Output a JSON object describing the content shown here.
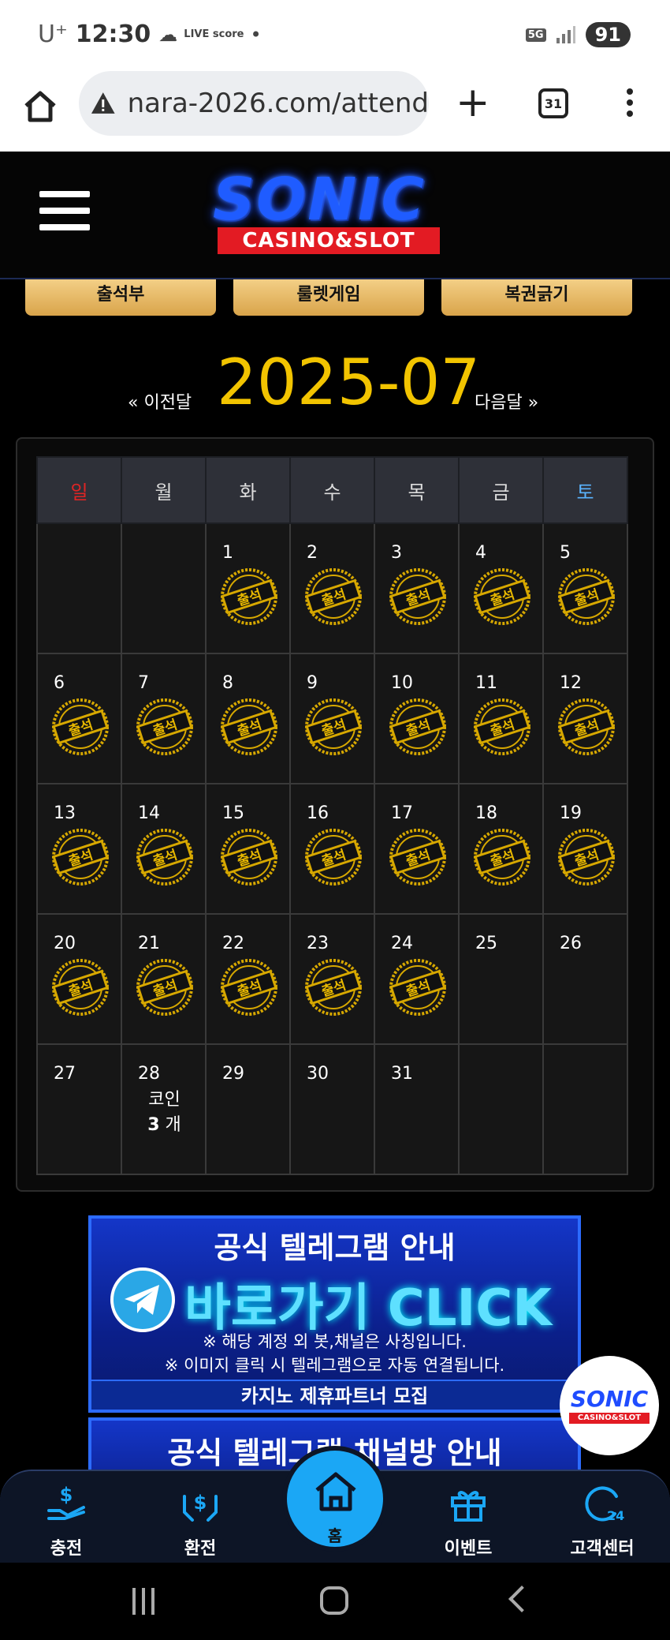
{
  "status_bar": {
    "carrier": "U⁺",
    "time": "12:30",
    "live_label": "LIVE score",
    "network": "5G",
    "battery": "91"
  },
  "browser": {
    "url": "nara-2026.com/attend",
    "tab_count": "31"
  },
  "site": {
    "logo_main": "SONIC",
    "logo_sub": "CASINO&SLOT"
  },
  "top_menu": [
    "출석부",
    "룰렛게임",
    "복권긁기"
  ],
  "calendar": {
    "prev_label": "« 이전달",
    "month_title": "2025-07",
    "next_label": "다음달 »",
    "weekdays": [
      "일",
      "월",
      "화",
      "수",
      "목",
      "금",
      "토"
    ],
    "weeks": [
      [
        "",
        "",
        "1",
        "2",
        "3",
        "4",
        "5"
      ],
      [
        "6",
        "7",
        "8",
        "9",
        "10",
        "11",
        "12"
      ],
      [
        "13",
        "14",
        "15",
        "16",
        "17",
        "18",
        "19"
      ],
      [
        "20",
        "21",
        "22",
        "23",
        "24",
        "25",
        "26"
      ],
      [
        "27",
        "28",
        "29",
        "30",
        "31",
        "",
        ""
      ]
    ],
    "attended_days": [
      "1",
      "2",
      "3",
      "4",
      "5",
      "6",
      "7",
      "8",
      "9",
      "10",
      "11",
      "12",
      "13",
      "14",
      "15",
      "16",
      "17",
      "18",
      "19",
      "20",
      "21",
      "22",
      "23",
      "24"
    ],
    "stamp_text": "출석",
    "coin_day": "28",
    "coin_label": "코인",
    "coin_count": "3",
    "coin_unit": "개"
  },
  "banners": {
    "banner1_title": "공식 텔레그램 안내",
    "banner1_cta": "바로가기 CLICK",
    "banner1_note1": "※ 해당 계정 외 봇,채널은 사칭입니다.",
    "banner1_note2": "※ 이미지 클릭 시 텔레그램으로 자동 연결됩니다.",
    "banner1_footer": "카지노 제휴파트너 모집",
    "banner2_title": "공식 텔레그램 채널방 안내"
  },
  "float_logo": {
    "main": "SONIC",
    "sub": "CASINO&SLOT"
  },
  "bottom_nav": {
    "charge": "충전",
    "exchange": "환전",
    "home": "홈",
    "event": "이벤트",
    "support": "고객센터"
  },
  "colors": {
    "accent_gold": "#f2c400",
    "accent_blue": "#1ba7f5",
    "sunday": "#e02424",
    "saturday": "#5ab4ff"
  }
}
